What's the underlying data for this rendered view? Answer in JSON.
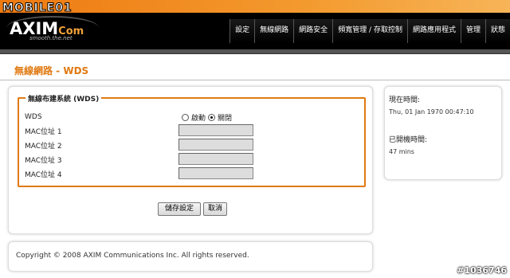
{
  "watermark_top": "MOBILE01",
  "logo": {
    "main": "AXIM",
    "suffix": "Com",
    "tagline": "smooth.the.net"
  },
  "nav": [
    "設定",
    "無線網路",
    "網路安全",
    "頻寬管理 / 存取控制",
    "網路應用程式",
    "管理",
    "狀態"
  ],
  "page_title": "無線網路 - WDS",
  "section": {
    "legend": "無線布建系統 (WDS)",
    "wds_label": "WDS",
    "wds_options": [
      "啟動",
      "關閉"
    ],
    "wds_selected": "關閉",
    "mac_fields": [
      {
        "label": "MAC位址 1",
        "value": ""
      },
      {
        "label": "MAC位址 2",
        "value": ""
      },
      {
        "label": "MAC位址 3",
        "value": ""
      },
      {
        "label": "MAC位址 4",
        "value": ""
      }
    ]
  },
  "buttons": {
    "save": "儲存設定",
    "cancel": "取消"
  },
  "status": {
    "current_time_label": "現在時間:",
    "current_time": "Thu, 01 Jan 1970 00:47:10",
    "uptime_label": "已開機時間:",
    "uptime": "47 mins"
  },
  "footer": {
    "copyright": "Copyright © 2008 AXIM Communications Inc. All rights reserved."
  },
  "watermark_bottom": "#1036746",
  "colors": {
    "accent": "#e07a12",
    "header": "#000000"
  }
}
